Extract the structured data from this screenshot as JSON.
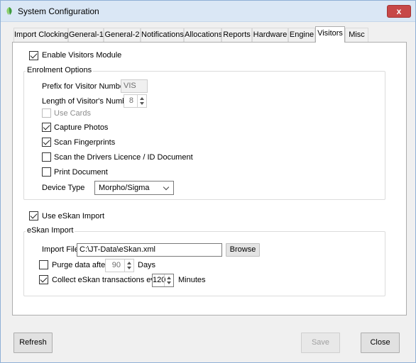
{
  "window": {
    "title": "System Configuration",
    "close_glyph": "x",
    "accent": "#dae7f5"
  },
  "tabs": [
    {
      "label": "Import Clockings"
    },
    {
      "label": "General-1"
    },
    {
      "label": "General-2"
    },
    {
      "label": "Notifications"
    },
    {
      "label": "Allocations"
    },
    {
      "label": "Reports"
    },
    {
      "label": "Hardware"
    },
    {
      "label": "Engine"
    },
    {
      "label": "Visitors",
      "active": true
    },
    {
      "label": "Misc"
    }
  ],
  "visitors": {
    "enable_label": "Enable Visitors Module",
    "enable_checked": true,
    "enrolment": {
      "group_title": "Enrolment Options",
      "prefix_label": "Prefix for Visitor Number",
      "prefix_value": "VIS",
      "length_label": "Length of Visitor's Number",
      "length_value": "8",
      "use_cards_label": "Use Cards",
      "use_cards_checked": false,
      "capture_photos_label": "Capture  Photos",
      "capture_photos_checked": true,
      "scan_fingerprints_label": "Scan Fingerprints",
      "scan_fingerprints_checked": true,
      "scan_licence_label": "Scan the Drivers Licence / ID Document",
      "scan_licence_checked": false,
      "print_document_label": "Print Document",
      "print_document_checked": false,
      "device_type_label": "Device Type",
      "device_type_value": "Morpho/Sigma"
    },
    "eskan_enable_label": "Use eSkan Import",
    "eskan_enable_checked": true,
    "eskan": {
      "group_title": "eSkan Import",
      "import_file_label": "Import File",
      "import_file_value": "C:\\JT-Data\\eSkan.xml",
      "browse_label": "Browse",
      "purge_label": "Purge data after",
      "purge_checked": false,
      "purge_value": "90",
      "days_label": "Days",
      "collect_label": "Collect eSkan transactions every",
      "collect_checked": true,
      "collect_value": "120",
      "minutes_label": "Minutes"
    }
  },
  "footer": {
    "refresh_label": "Refresh",
    "save_label": "Save",
    "close_label": "Close"
  }
}
